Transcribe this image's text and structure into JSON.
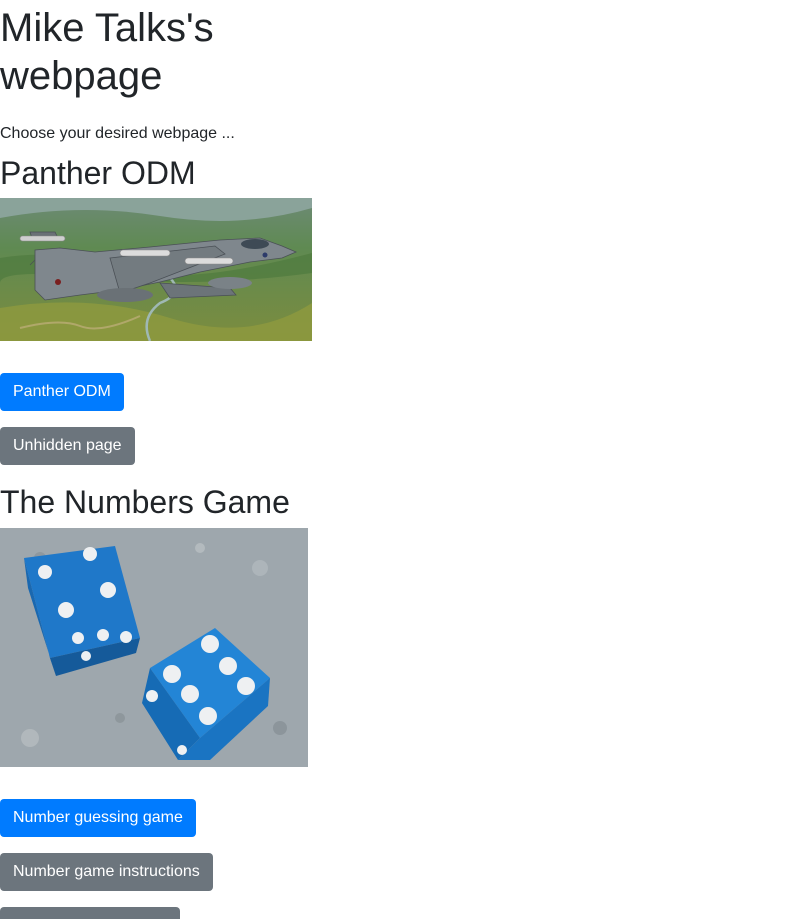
{
  "site": {
    "title": "Mike Talks's webpage",
    "intro": "Choose your desired webpage ..."
  },
  "sections": [
    {
      "heading": "Panther ODM",
      "image_subject": "jet-aircraft-photo",
      "buttons": [
        {
          "label": "Panther ODM",
          "style": "primary"
        },
        {
          "label": "Unhidden page",
          "style": "secondary"
        }
      ]
    },
    {
      "heading": "The Numbers Game",
      "image_subject": "blue-dice-photo",
      "buttons": [
        {
          "label": "Number guessing game",
          "style": "primary"
        },
        {
          "label": "Number game instructions",
          "style": "secondary"
        },
        {
          "label": "",
          "style": "secondary"
        }
      ]
    }
  ],
  "colors": {
    "primary": "#007bff",
    "secondary": "#6c757d",
    "text": "#212529"
  }
}
